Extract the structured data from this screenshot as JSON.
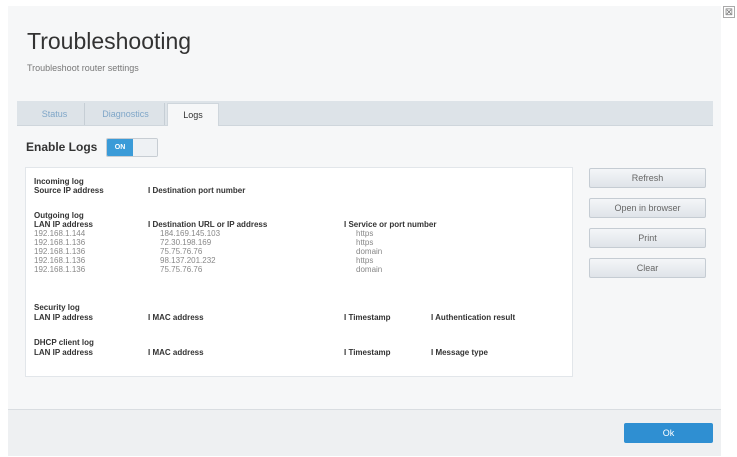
{
  "window": {
    "close_glyph": "⊠"
  },
  "header": {
    "title": "Troubleshooting",
    "subtitle": "Troubleshoot router settings"
  },
  "tabs": [
    {
      "label": "Status",
      "active": false
    },
    {
      "label": "Diagnostics",
      "active": false
    },
    {
      "label": "Logs",
      "active": true
    }
  ],
  "enable_logs": {
    "label": "Enable Logs",
    "state": "ON"
  },
  "logs": {
    "incoming": {
      "title": "Incoming log",
      "columns": [
        "Source IP address",
        "I  Destination port number"
      ]
    },
    "outgoing": {
      "title": "Outgoing log",
      "columns": [
        "LAN IP address",
        "I  Destination URL or IP address",
        "I  Service or port number"
      ],
      "rows": [
        [
          "192.168.1.144",
          "184.169.145.103",
          "https"
        ],
        [
          "192.168.1.136",
          "72.30.198.169",
          "https"
        ],
        [
          "192.168.1.136",
          "75.75.76.76",
          "domain"
        ],
        [
          "192.168.1.136",
          "98.137.201.232",
          "https"
        ],
        [
          "192.168.1.136",
          "75.75.76.76",
          "domain"
        ]
      ]
    },
    "security": {
      "title": "Security log",
      "columns": [
        "LAN IP address",
        "I  MAC address",
        "I  Timestamp",
        "I  Authentication result"
      ]
    },
    "dhcp": {
      "title": "DHCP client log",
      "columns": [
        "LAN IP address",
        "I  MAC address",
        "I  Timestamp",
        "I  Message type"
      ]
    }
  },
  "actions": {
    "refresh": "Refresh",
    "open_browser": "Open in browser",
    "print": "Print",
    "clear": "Clear"
  },
  "footer": {
    "ok": "Ok"
  },
  "colors": {
    "accent": "#3a9bd8",
    "tab_text": "#7fa6c8"
  }
}
